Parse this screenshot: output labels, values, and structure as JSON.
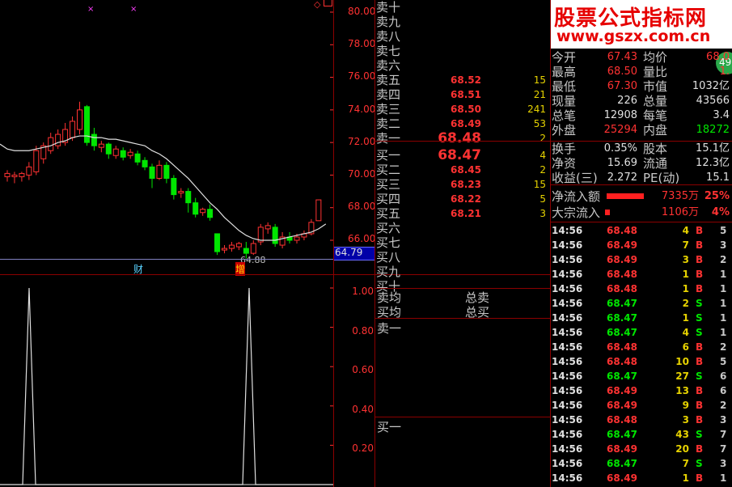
{
  "chart": {
    "y_ticks": [
      "80.00",
      "78.00",
      "76.00",
      "74.00",
      "72.00",
      "70.00",
      "68.00",
      "66.00"
    ],
    "price_tag": "64.79",
    "low_label": "64.88",
    "marker_cai": "财",
    "marker_zeng": "增",
    "sub_ticks": [
      "1.00",
      "0.80",
      "0.60",
      "0.40",
      "0.20"
    ],
    "markers": [
      "×",
      "×"
    ]
  },
  "chart_data": {
    "type": "candlestick",
    "ylim": [
      64.5,
      80.5
    ],
    "candles": [
      {
        "o": 69.9,
        "c": 70.1,
        "h": 70.3,
        "l": 69.6
      },
      {
        "o": 69.9,
        "c": 70.0,
        "h": 70.2,
        "l": 69.5
      },
      {
        "o": 69.9,
        "c": 70.1,
        "h": 70.2,
        "l": 69.6
      },
      {
        "o": 70.0,
        "c": 70.5,
        "h": 70.8,
        "l": 69.7
      },
      {
        "o": 70.2,
        "c": 71.5,
        "h": 71.8,
        "l": 70.0
      },
      {
        "o": 71.0,
        "c": 71.8,
        "h": 72.0,
        "l": 70.7
      },
      {
        "o": 71.5,
        "c": 72.3,
        "h": 72.6,
        "l": 71.3
      },
      {
        "o": 71.8,
        "c": 72.5,
        "h": 72.8,
        "l": 71.6
      },
      {
        "o": 72.0,
        "c": 72.8,
        "h": 73.2,
        "l": 71.8
      },
      {
        "o": 72.3,
        "c": 73.3,
        "h": 73.6,
        "l": 72.1
      },
      {
        "o": 72.8,
        "c": 74.0,
        "h": 74.5,
        "l": 72.5
      },
      {
        "o": 74.2,
        "c": 72.0,
        "h": 74.3,
        "l": 71.8
      },
      {
        "o": 72.5,
        "c": 71.8,
        "h": 72.9,
        "l": 71.5
      },
      {
        "o": 71.7,
        "c": 71.9,
        "h": 72.1,
        "l": 71.4
      },
      {
        "o": 71.9,
        "c": 71.3,
        "h": 72.0,
        "l": 71.0
      },
      {
        "o": 71.2,
        "c": 71.6,
        "h": 71.8,
        "l": 71.0
      },
      {
        "o": 71.5,
        "c": 71.1,
        "h": 71.7,
        "l": 70.9
      },
      {
        "o": 71.2,
        "c": 71.4,
        "h": 71.6,
        "l": 71.0
      },
      {
        "o": 71.3,
        "c": 70.8,
        "h": 71.5,
        "l": 70.6
      },
      {
        "o": 70.9,
        "c": 70.5,
        "h": 71.1,
        "l": 70.3
      },
      {
        "o": 70.5,
        "c": 69.8,
        "h": 70.7,
        "l": 69.2
      },
      {
        "o": 69.8,
        "c": 70.6,
        "h": 70.9,
        "l": 69.7
      },
      {
        "o": 70.6,
        "c": 69.8,
        "h": 70.8,
        "l": 69.5
      },
      {
        "o": 69.8,
        "c": 68.8,
        "h": 70.0,
        "l": 68.5
      },
      {
        "o": 68.9,
        "c": 69.0,
        "h": 69.2,
        "l": 68.6
      },
      {
        "o": 69.0,
        "c": 68.3,
        "h": 69.2,
        "l": 67.7
      },
      {
        "o": 68.3,
        "c": 67.6,
        "h": 68.6,
        "l": 67.4
      },
      {
        "o": 67.7,
        "c": 67.9,
        "h": 68.0,
        "l": 67.5
      },
      {
        "o": 67.9,
        "c": 67.4,
        "h": 68.2,
        "l": 67.2
      },
      {
        "o": 66.4,
        "c": 65.3,
        "h": 66.4,
        "l": 65.1
      },
      {
        "o": 65.4,
        "c": 65.5,
        "h": 65.7,
        "l": 65.2
      },
      {
        "o": 65.5,
        "c": 65.7,
        "h": 65.9,
        "l": 65.3
      },
      {
        "o": 65.6,
        "c": 65.8,
        "h": 65.9,
        "l": 65.4
      },
      {
        "o": 65.5,
        "c": 65.2,
        "h": 65.9,
        "l": 64.88
      },
      {
        "o": 65.2,
        "c": 65.8,
        "h": 66.0,
        "l": 65.1
      },
      {
        "o": 65.9,
        "c": 66.8,
        "h": 67.0,
        "l": 65.7
      },
      {
        "o": 66.7,
        "c": 66.9,
        "h": 67.1,
        "l": 66.4
      },
      {
        "o": 66.8,
        "c": 65.8,
        "h": 67.0,
        "l": 65.6
      },
      {
        "o": 65.7,
        "c": 66.2,
        "h": 66.5,
        "l": 65.5
      },
      {
        "o": 66.2,
        "c": 66.0,
        "h": 66.5,
        "l": 65.8
      },
      {
        "o": 66.0,
        "c": 66.2,
        "h": 66.4,
        "l": 65.8
      },
      {
        "o": 66.2,
        "c": 66.4,
        "h": 66.6,
        "l": 66.0
      },
      {
        "o": 66.4,
        "c": 67.1,
        "h": 67.3,
        "l": 66.3
      },
      {
        "o": 67.2,
        "c": 68.48,
        "h": 68.5,
        "l": 67.3
      }
    ],
    "ma": [
      71.6,
      71.5,
      71.5,
      71.5,
      71.6,
      71.7,
      71.8,
      72.0,
      72.1,
      72.3,
      72.4,
      72.4,
      72.3,
      72.3,
      72.2,
      72.2,
      72.1,
      72.0,
      71.9,
      71.8,
      71.5,
      71.3,
      71.0,
      70.6,
      70.2,
      69.8,
      69.3,
      68.8,
      68.3,
      67.9,
      67.4,
      67.0,
      66.6,
      66.3,
      66.1,
      66.0,
      66.0,
      66.0,
      66.1,
      66.2,
      66.3,
      66.4,
      66.5,
      66.7,
      67.0
    ],
    "indicator": [
      {
        "x": 36,
        "y": 1.0
      },
      {
        "x": 308,
        "y": 1.0
      }
    ]
  },
  "orderbook": {
    "asks": [
      {
        "label": "卖十",
        "price": "",
        "vol": ""
      },
      {
        "label": "卖九",
        "price": "",
        "vol": ""
      },
      {
        "label": "卖八",
        "price": "",
        "vol": ""
      },
      {
        "label": "卖七",
        "price": "",
        "vol": ""
      },
      {
        "label": "卖六",
        "price": "",
        "vol": ""
      },
      {
        "label": "卖五",
        "price": "68.52",
        "vol": "15"
      },
      {
        "label": "卖四",
        "price": "68.51",
        "vol": "21"
      },
      {
        "label": "卖三",
        "price": "68.50",
        "vol": "241"
      },
      {
        "label": "卖二",
        "price": "68.49",
        "vol": "53"
      },
      {
        "label": "卖一",
        "price": "68.48",
        "vol": "2"
      }
    ],
    "bids": [
      {
        "label": "买一",
        "price": "68.47",
        "vol": "4"
      },
      {
        "label": "买二",
        "price": "68.45",
        "vol": "2"
      },
      {
        "label": "买三",
        "price": "68.23",
        "vol": "15"
      },
      {
        "label": "买四",
        "price": "68.22",
        "vol": "5"
      },
      {
        "label": "买五",
        "price": "68.21",
        "vol": "3"
      },
      {
        "label": "买六",
        "price": "",
        "vol": ""
      },
      {
        "label": "买七",
        "price": "",
        "vol": ""
      },
      {
        "label": "买八",
        "price": "",
        "vol": ""
      },
      {
        "label": "买九",
        "price": "",
        "vol": ""
      },
      {
        "label": "买十",
        "price": "",
        "vol": ""
      }
    ],
    "sell_avg": "卖均",
    "buy_avg": "买均",
    "total_sell": "总卖",
    "total_buy": "总买",
    "panel_sell1": "卖一",
    "panel_buy1": "买一"
  },
  "watermark": {
    "title": "股票公式指标网",
    "url": "www.gszx.com.cn",
    "badge": "49"
  },
  "quote": [
    {
      "l1": "今开",
      "v1": "67.43",
      "c1": "red",
      "l2": "均价",
      "v2": "68.0",
      "c2": "red"
    },
    {
      "l1": "最高",
      "v1": "68.50",
      "c1": "red",
      "l2": "量比",
      "v2": "1.",
      "c2": "red"
    },
    {
      "l1": "最低",
      "v1": "67.30",
      "c1": "red",
      "l2": "市值",
      "v2": "1032亿",
      "c2": "white"
    },
    {
      "l1": "现量",
      "v1": "226",
      "c1": "white",
      "l2": "总量",
      "v2": "43566",
      "c2": "white"
    },
    {
      "l1": "总笔",
      "v1": "12908",
      "c1": "white",
      "l2": "每笔",
      "v2": "3.4",
      "c2": "white"
    },
    {
      "l1": "外盘",
      "v1": "25294",
      "c1": "red",
      "l2": "内盘",
      "v2": "18272",
      "c2": "green"
    },
    {
      "l1": "换手",
      "v1": "0.35%",
      "c1": "white",
      "l2": "股本",
      "v2": "15.1亿",
      "c2": "white"
    },
    {
      "l1": "净资",
      "v1": "15.69",
      "c1": "white",
      "l2": "流通",
      "v2": "12.3亿",
      "c2": "white"
    },
    {
      "l1": "收益(三)",
      "v1": "2.272",
      "c1": "white",
      "l2": "PE(动)",
      "v2": "15.1",
      "c2": "white"
    }
  ],
  "flow": [
    {
      "label": "净流入额",
      "value": "7335万",
      "pct": "25%",
      "bar": 0.35
    },
    {
      "label": "大宗流入",
      "value": "1106万",
      "pct": "4%",
      "bar": 0.03
    }
  ],
  "ticks": [
    {
      "t": "14:56",
      "p": "68.48",
      "v": "4",
      "d": "B",
      "n": "5"
    },
    {
      "t": "14:56",
      "p": "68.49",
      "v": "7",
      "d": "B",
      "n": "3"
    },
    {
      "t": "14:56",
      "p": "68.49",
      "v": "3",
      "d": "B",
      "n": "2"
    },
    {
      "t": "14:56",
      "p": "68.48",
      "v": "1",
      "d": "B",
      "n": "1"
    },
    {
      "t": "14:56",
      "p": "68.48",
      "v": "1",
      "d": "B",
      "n": "1"
    },
    {
      "t": "14:56",
      "p": "68.47",
      "v": "2",
      "d": "S",
      "n": "1"
    },
    {
      "t": "14:56",
      "p": "68.47",
      "v": "1",
      "d": "S",
      "n": "1"
    },
    {
      "t": "14:56",
      "p": "68.47",
      "v": "4",
      "d": "S",
      "n": "1"
    },
    {
      "t": "14:56",
      "p": "68.48",
      "v": "6",
      "d": "B",
      "n": "2"
    },
    {
      "t": "14:56",
      "p": "68.48",
      "v": "10",
      "d": "B",
      "n": "5"
    },
    {
      "t": "14:56",
      "p": "68.47",
      "v": "27",
      "d": "S",
      "n": "6"
    },
    {
      "t": "14:56",
      "p": "68.49",
      "v": "13",
      "d": "B",
      "n": "6"
    },
    {
      "t": "14:56",
      "p": "68.49",
      "v": "9",
      "d": "B",
      "n": "2"
    },
    {
      "t": "14:56",
      "p": "68.48",
      "v": "3",
      "d": "B",
      "n": "3"
    },
    {
      "t": "14:56",
      "p": "68.47",
      "v": "43",
      "d": "S",
      "n": "7"
    },
    {
      "t": "14:56",
      "p": "68.49",
      "v": "20",
      "d": "B",
      "n": "7"
    },
    {
      "t": "14:56",
      "p": "68.47",
      "v": "7",
      "d": "S",
      "n": "3"
    },
    {
      "t": "14:56",
      "p": "68.49",
      "v": "1",
      "d": "B",
      "n": "1"
    }
  ]
}
